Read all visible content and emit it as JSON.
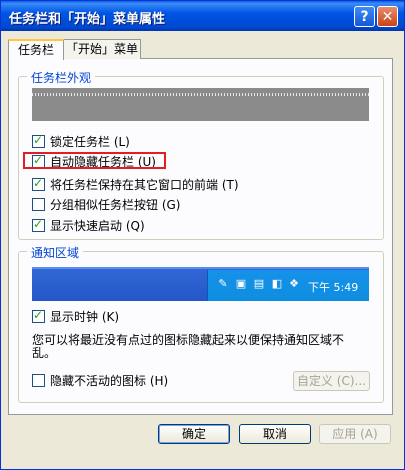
{
  "window": {
    "title": "任务栏和「开始」菜单属性"
  },
  "titlebar": {
    "help_glyph": "?",
    "close_glyph": "✕"
  },
  "tabs": [
    {
      "label": "任务栏",
      "active": true
    },
    {
      "label": "「开始」菜单",
      "active": false
    }
  ],
  "appearance": {
    "title": "任务栏外观",
    "options": [
      {
        "label": "锁定任务栏 (L)",
        "checked": true
      },
      {
        "label": "自动隐藏任务栏 (U)",
        "checked": true
      },
      {
        "label": "将任务栏保持在其它窗口的前端 (T)",
        "checked": true
      },
      {
        "label": "分组相似任务栏按钮 (G)",
        "checked": false
      },
      {
        "label": "显示快速启动 (Q)",
        "checked": true
      }
    ]
  },
  "notification": {
    "title": "通知区域",
    "clock_preview": "下午 5:49",
    "show_clock": {
      "label": "显示时钟 (K)",
      "checked": true
    },
    "description": "您可以将最近没有点过的图标隐藏起来以便保持通知区域不乱。",
    "hide_inactive": {
      "label": "隐藏不活动的图标 (H)",
      "checked": false
    },
    "customize_label": "自定义 (C)..."
  },
  "footer": {
    "ok_label": "确定",
    "cancel_label": "取消",
    "apply_label": "应用 (A)"
  },
  "colors": {
    "title_bar": "#0055e5",
    "group_title": "#0046d5",
    "highlight_border": "#e02020"
  }
}
